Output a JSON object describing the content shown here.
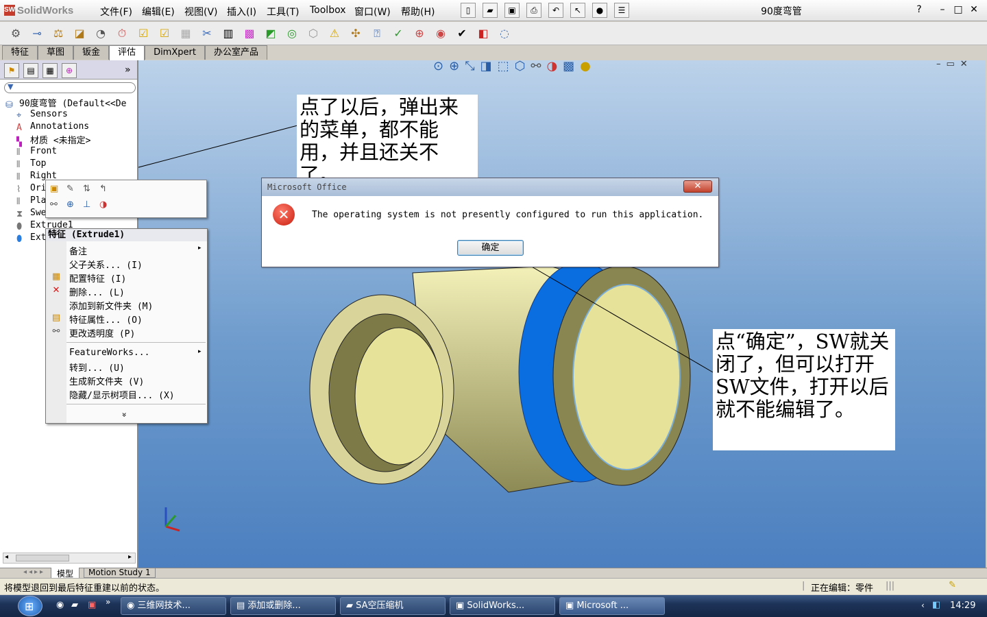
{
  "app": {
    "name": "SolidWorks",
    "doc_title": "90度弯管"
  },
  "menus": [
    "文件(F)",
    "编辑(E)",
    "视图(V)",
    "插入(I)",
    "工具(T)",
    "Toolbox",
    "窗口(W)",
    "帮助(H)"
  ],
  "window_buttons": [
    "?",
    "–",
    "□",
    "✕"
  ],
  "tabs": [
    {
      "label": "特征"
    },
    {
      "label": "草图"
    },
    {
      "label": "钣金"
    },
    {
      "label": "评估",
      "active": true
    },
    {
      "label": "DimXpert"
    },
    {
      "label": "办公室产品"
    }
  ],
  "tree": {
    "root": "90度弯管   (Default<<De",
    "items": [
      "Sensors",
      "Annotations",
      "材质 <未指定>",
      "Front",
      "Top",
      "Right",
      "Ori",
      "Pla",
      "Swe",
      "Extrude1",
      "Ext"
    ]
  },
  "context_menu": {
    "header": "特征 (Extrude1)",
    "items": [
      "备注",
      "父子关系... (I)",
      "配置特征 (I)",
      "删除... (L)",
      "添加到新文件夹 (M)",
      "特征属性... (O)",
      "更改透明度 (P)"
    ],
    "items2": [
      "FeatureWorks...",
      "转到... (U)",
      "生成新文件夹 (V)",
      "隐藏/显示树项目... (X)"
    ],
    "more": "»"
  },
  "dialog": {
    "title": "Microsoft Office",
    "close": "✕",
    "message": "The operating system is not presently configured to run this application.",
    "ok": "确定"
  },
  "notes": {
    "top": "点了以后，弹出来的菜单，都不能用，并且还关不了。",
    "right": "点“确定”，SW就关闭了，但可以打开SW文件，打开以后就不能编辑了。"
  },
  "bottom_tabs": [
    "模型",
    "Motion Study 1"
  ],
  "status": {
    "left": "将模型退回到最后特征重建以前的状态。",
    "right": "正在编辑：零件"
  },
  "taskbar": {
    "tasks": [
      "三维网技术...",
      "添加或删除...",
      "SA空压缩机",
      "SolidWorks...",
      "Microsoft ..."
    ],
    "clock": "14:29"
  },
  "colors": {
    "viewport_top": "#bcd2ea",
    "viewport_bottom": "#4b7fbf",
    "part": "#e6e29a",
    "selected_face": "#0a6ee0"
  }
}
